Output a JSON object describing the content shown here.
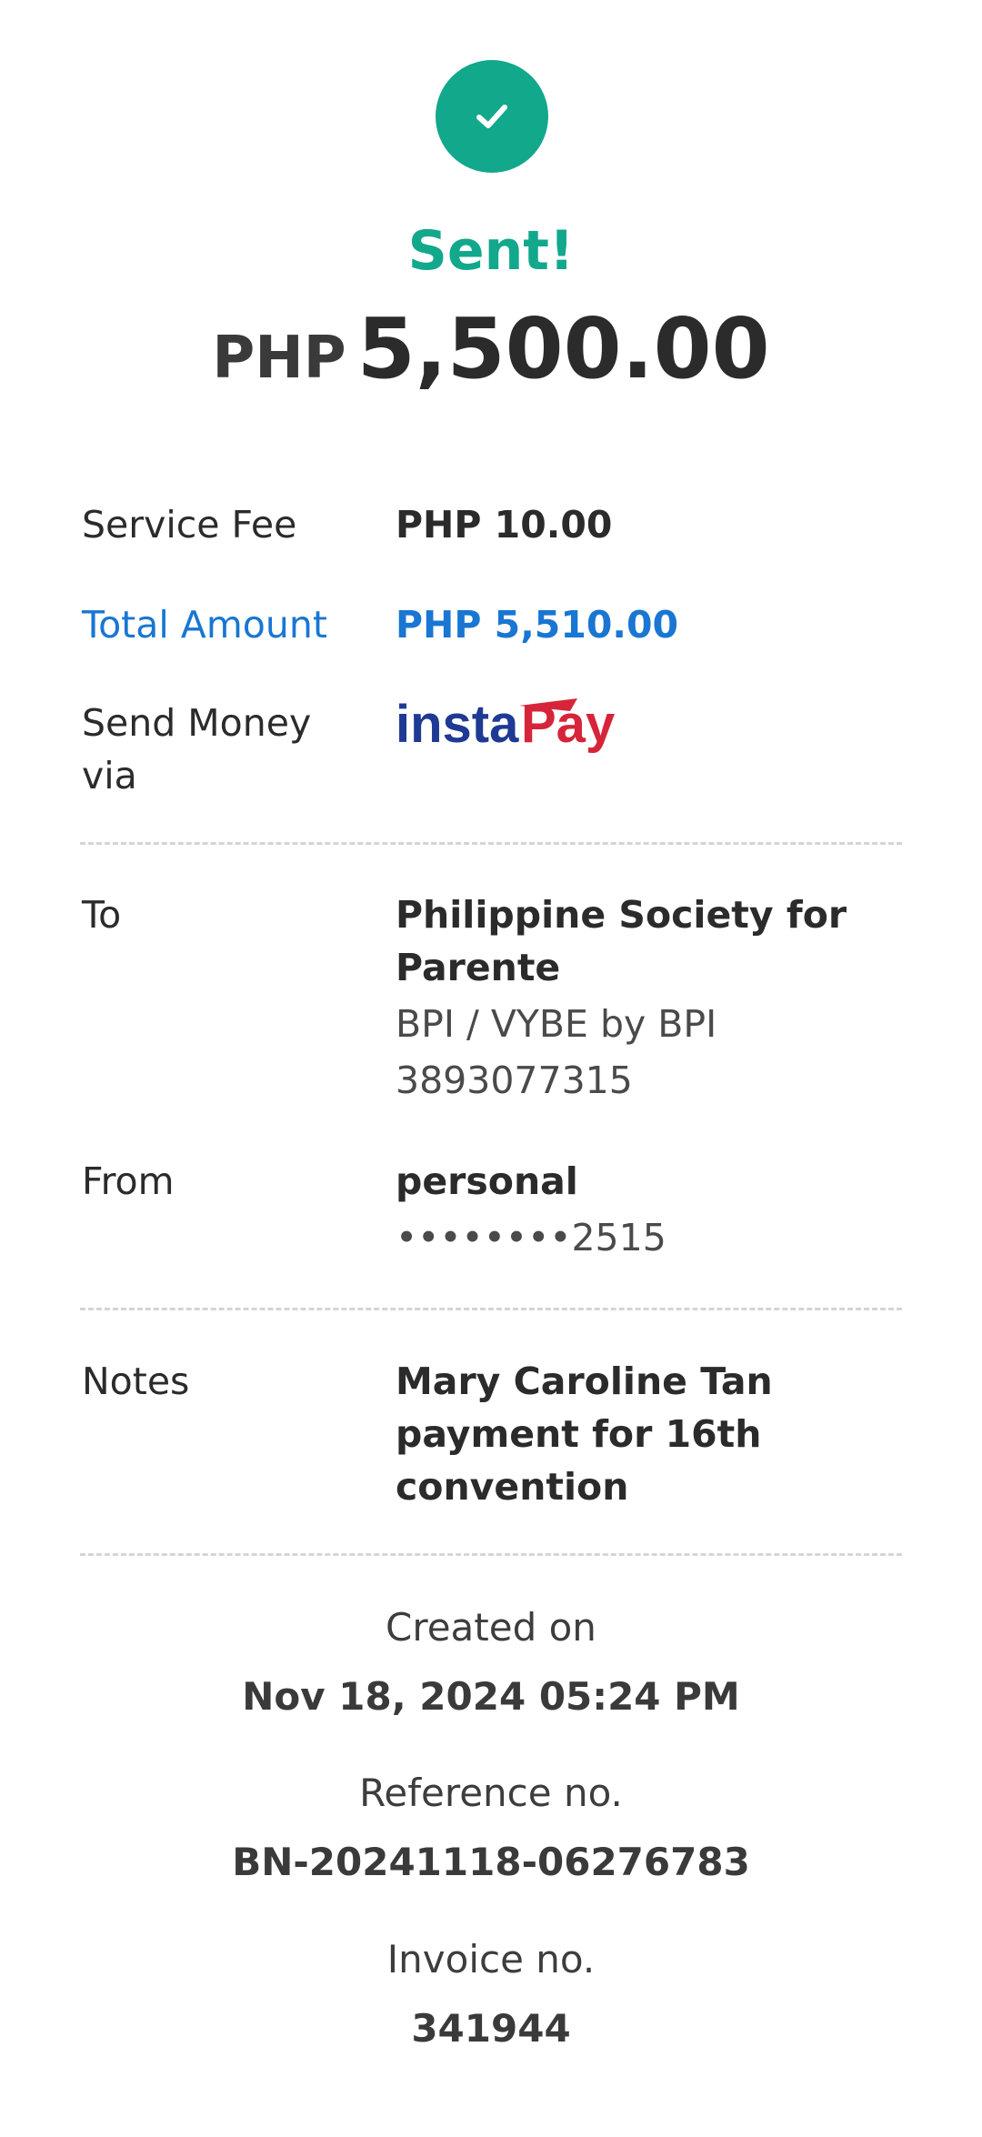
{
  "header": {
    "status": "Sent!",
    "currency": "PHP",
    "amount": "5,500.00"
  },
  "details": {
    "service_fee_label": "Service Fee",
    "service_fee_value": "PHP 10.00",
    "total_label": "Total Amount",
    "total_value": "PHP 5,510.00",
    "via_label": "Send Money via",
    "via_value": "instaPay"
  },
  "recipient": {
    "to_label": "To",
    "name": "Philippine Society for Parente",
    "bank": "BPI / VYBE by BPI",
    "account": "3893077315",
    "from_label": "From",
    "from_name": "personal",
    "from_account": "••••••••2515"
  },
  "notes": {
    "label": "Notes",
    "value": "Mary Caroline Tan payment for 16th convention"
  },
  "meta": {
    "created_label": "Created on",
    "created_value": "Nov 18, 2024 05:24 PM",
    "reference_label": "Reference no.",
    "reference_value": "BN-20241118-06276783",
    "invoice_label": "Invoice no.",
    "invoice_value": "341944"
  },
  "colors": {
    "success": "#12a88c",
    "accent_blue": "#1976d2",
    "instapay_blue": "#1f3a93",
    "instapay_red": "#d6253a"
  },
  "icons": {
    "status": "check-icon"
  }
}
